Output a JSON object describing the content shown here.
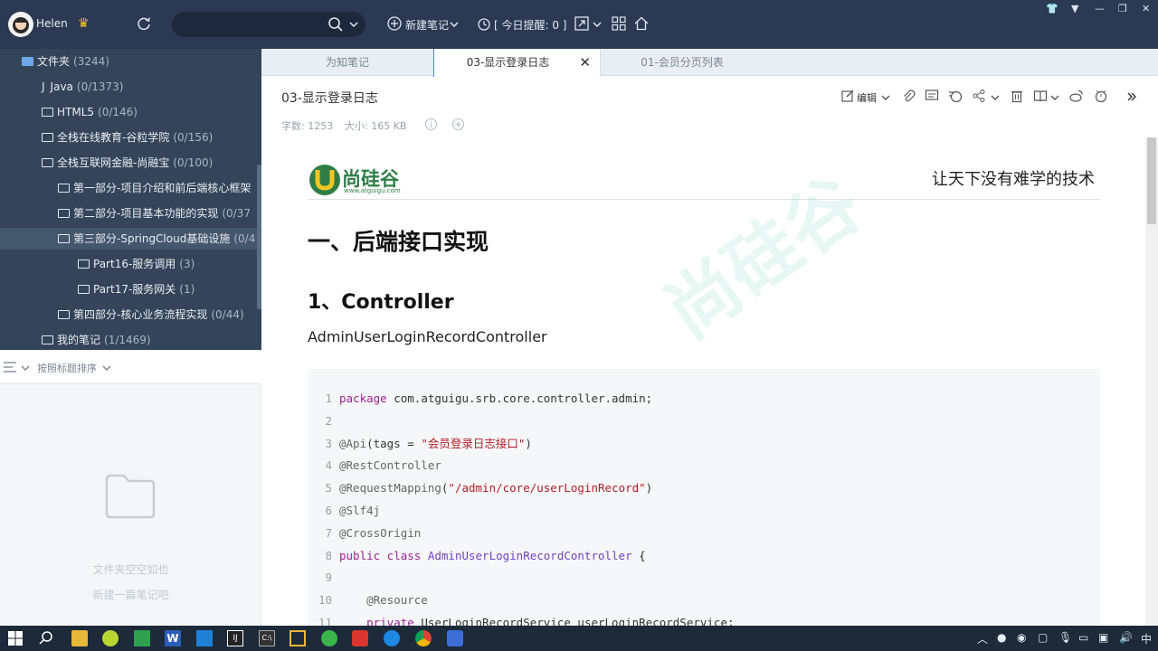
{
  "header": {
    "username": "Helen",
    "new_note_label": "新建笔记",
    "reminder_label": "[ 今日提醒:  0 ]"
  },
  "sidebar": {
    "items": [
      {
        "label": "文件夹",
        "count": "(3244)"
      },
      {
        "label": "Java",
        "count": "(0/1373)"
      },
      {
        "label": "HTML5",
        "count": "(0/146)"
      },
      {
        "label": "全栈在线教育-谷粒学院",
        "count": "(0/156)"
      },
      {
        "label": "全栈互联网金融-尚融宝",
        "count": "(0/100)"
      },
      {
        "label": "第一部分-项目介绍和前后端核心框架",
        "count": ""
      },
      {
        "label": "第二部分-项目基本功能的实现",
        "count": "(0/37"
      },
      {
        "label": "第三部分-SpringCloud基础设施",
        "count": "(0/4"
      },
      {
        "label": "Part16-服务调用",
        "count": "(3)"
      },
      {
        "label": "Part17-服务网关",
        "count": "(1)"
      },
      {
        "label": "第四部分-核心业务流程实现",
        "count": "(0/44)"
      },
      {
        "label": "我的笔记",
        "count": "(1/1469)"
      }
    ]
  },
  "list_pane": {
    "sort_label": "按照标题排序",
    "empty_line1": "文件夹空空如也",
    "empty_line2": "新建一篇笔记吧"
  },
  "tabs": [
    {
      "label": "为知笔记"
    },
    {
      "label": "03-显示登录日志"
    },
    {
      "label": "01-会员分页列表"
    }
  ],
  "note": {
    "title": "03-显示登录日志",
    "word_count": "字数: 1253",
    "size": "大小: 165 KB",
    "edit_label": "编辑"
  },
  "document": {
    "logo_text": "尚硅谷",
    "logo_url": "www.atguigu.com",
    "slogan": "让天下没有难学的技术",
    "h1": "一、后端接口实现",
    "h2": "1、Controller",
    "para": "AdminUserLoginRecordController",
    "watermark": "尚硅谷",
    "code_lines": [
      {
        "n": "1",
        "parts": [
          [
            "kw",
            "package"
          ],
          [
            "",
            " com.atguigu.srb.core.controller.admin;"
          ]
        ]
      },
      {
        "n": "2",
        "parts": []
      },
      {
        "n": "3",
        "parts": [
          [
            "ann",
            "@Api"
          ],
          [
            "",
            "(tags = "
          ],
          [
            "str",
            "\"会员登录日志接口\""
          ],
          [
            "",
            ")"
          ]
        ]
      },
      {
        "n": "4",
        "parts": [
          [
            "ann",
            "@RestController"
          ]
        ]
      },
      {
        "n": "5",
        "parts": [
          [
            "ann",
            "@RequestMapping"
          ],
          [
            "",
            "("
          ],
          [
            "str",
            "\"/admin/core/userLoginRecord\""
          ],
          [
            "",
            ")"
          ]
        ]
      },
      {
        "n": "6",
        "parts": [
          [
            "ann",
            "@Slf4j"
          ]
        ]
      },
      {
        "n": "7",
        "parts": [
          [
            "ann",
            "@CrossOrigin"
          ]
        ]
      },
      {
        "n": "8",
        "parts": [
          [
            "kw",
            "public class"
          ],
          [
            "",
            " "
          ],
          [
            "cls",
            "AdminUserLoginRecordController"
          ],
          [
            "",
            " {"
          ]
        ]
      },
      {
        "n": "9",
        "parts": []
      },
      {
        "n": "10",
        "parts": [
          [
            "ann",
            "    @Resource"
          ]
        ]
      },
      {
        "n": "11",
        "parts": [
          [
            "kw",
            "    private"
          ],
          [
            "",
            " UserLoginRecordService userLoginRecordService;"
          ]
        ]
      }
    ]
  },
  "taskbar": {
    "lang": "中"
  },
  "colors": {
    "topbar": "#2b3a52",
    "sidebar": "#344559",
    "accent": "#3d88d8"
  }
}
